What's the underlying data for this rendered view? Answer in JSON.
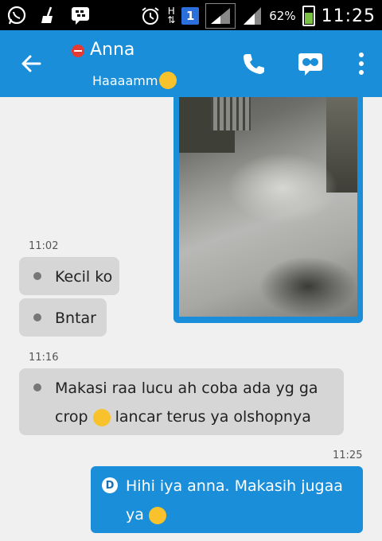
{
  "status_bar": {
    "network_label": "H",
    "sim_badge": "1",
    "battery_percent": "62%",
    "battery_level": 0.62,
    "time": "11:25"
  },
  "header": {
    "contact_name": "Anna",
    "contact_status": "Haaaamm",
    "accent": "#1a8ed8",
    "icons": [
      "back-arrow-icon",
      "phone-icon",
      "video-chat-icon",
      "overflow-menu-icon"
    ]
  },
  "messages": {
    "ts1": "11:02",
    "msg1": "Kecil ko",
    "msg2": "Bntar",
    "ts2": "11:16",
    "msg3_line1": "Makasi raa lucu ah coba ada yg ga",
    "msg3_line2a": "crop",
    "msg3_line2b": "lancar terus ya olshopnya",
    "ts3": "11:25",
    "out_badge": "D",
    "out_line1": "Hihi iya anna. Makasih jugaa",
    "out_line2": "ya"
  }
}
